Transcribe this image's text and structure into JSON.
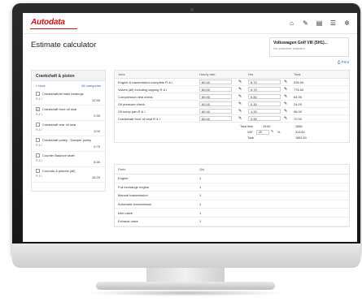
{
  "header": {
    "logo_text": "Autodata",
    "icons": [
      "home-icon",
      "wrench-icon",
      "document-icon",
      "list-icon",
      "gear-icon"
    ]
  },
  "page": {
    "title": "Estimate calculator",
    "vehicle_name": "Volkswagen Golf VIII (5H1)...",
    "vehicle_sub": "No customer selected",
    "print_label": "Print"
  },
  "left_panel": {
    "title": "Crankshaft & piston",
    "back_label": "« back",
    "all_categories_label": "All categories",
    "items": [
      {
        "label": "Crankshaft/all main bearings",
        "sub": "R & I",
        "value": "12.80",
        "checked": false
      },
      {
        "label": "Crankshaft front oil seal",
        "sub": "R & I",
        "value": "0.90",
        "checked": true
      },
      {
        "label": "Crankshaft rear oil seal",
        "sub": "R & I",
        "value": "3.00",
        "checked": false
      },
      {
        "label": "Crankshaft pulley - Damper pulley",
        "sub": "R & I",
        "value": "0.70",
        "checked": false
      },
      {
        "label": "Counter Balance shaft",
        "sub": "R & I",
        "value": "8.30",
        "checked": false
      },
      {
        "label": "Conrods & pistons (all)",
        "sub": "R & I",
        "value": "15.20",
        "checked": false
      }
    ]
  },
  "jobs": {
    "headers": [
      "Jobs",
      "Hourly rate",
      "",
      "Hrs",
      "",
      "Total"
    ],
    "rows": [
      {
        "job": "Engine & transmission complete R & I",
        "rate": "80.00",
        "hrs": "6.70",
        "total": "536.00"
      },
      {
        "job": "Valves (all) including lapping R & I",
        "rate": "80.00",
        "hrs": "9.70",
        "total": "776.00"
      },
      {
        "job": "Compression test check",
        "rate": "80.00",
        "hrs": "0.80",
        "total": "64.00"
      },
      {
        "job": "Oil pressure check",
        "rate": "80.00",
        "hrs": "0.30",
        "total": "24.00"
      },
      {
        "job": "Oil sump pan R & I",
        "rate": "80.00",
        "hrs": "1.20",
        "total": "96.00"
      },
      {
        "job": "Crankshaft front oil seal R & I",
        "rate": "80.00",
        "hrs": "0.90",
        "total": "72.00"
      }
    ],
    "total_time_label": "Total time",
    "total_time_value": "19.60",
    "total_time_amount": "1568",
    "vat_label": "VAT",
    "vat_value": "20",
    "vat_unit": "%",
    "vat_amount": "313.60",
    "total_label": "Total",
    "total_amount": "1881.60"
  },
  "parts": {
    "headers": [
      "Parts",
      "Qty"
    ],
    "rows": [
      {
        "part": "Engine",
        "qty": "1"
      },
      {
        "part": "Full exchange engine",
        "qty": "1"
      },
      {
        "part": "Manual transmission",
        "qty": "1"
      },
      {
        "part": "Automatic transmission",
        "qty": "1"
      },
      {
        "part": "Inlet valve",
        "qty": "1"
      },
      {
        "part": "Exhaust valve",
        "qty": "1"
      }
    ]
  },
  "colors": {
    "brand": "#c9141b",
    "link": "#2f6db5"
  }
}
